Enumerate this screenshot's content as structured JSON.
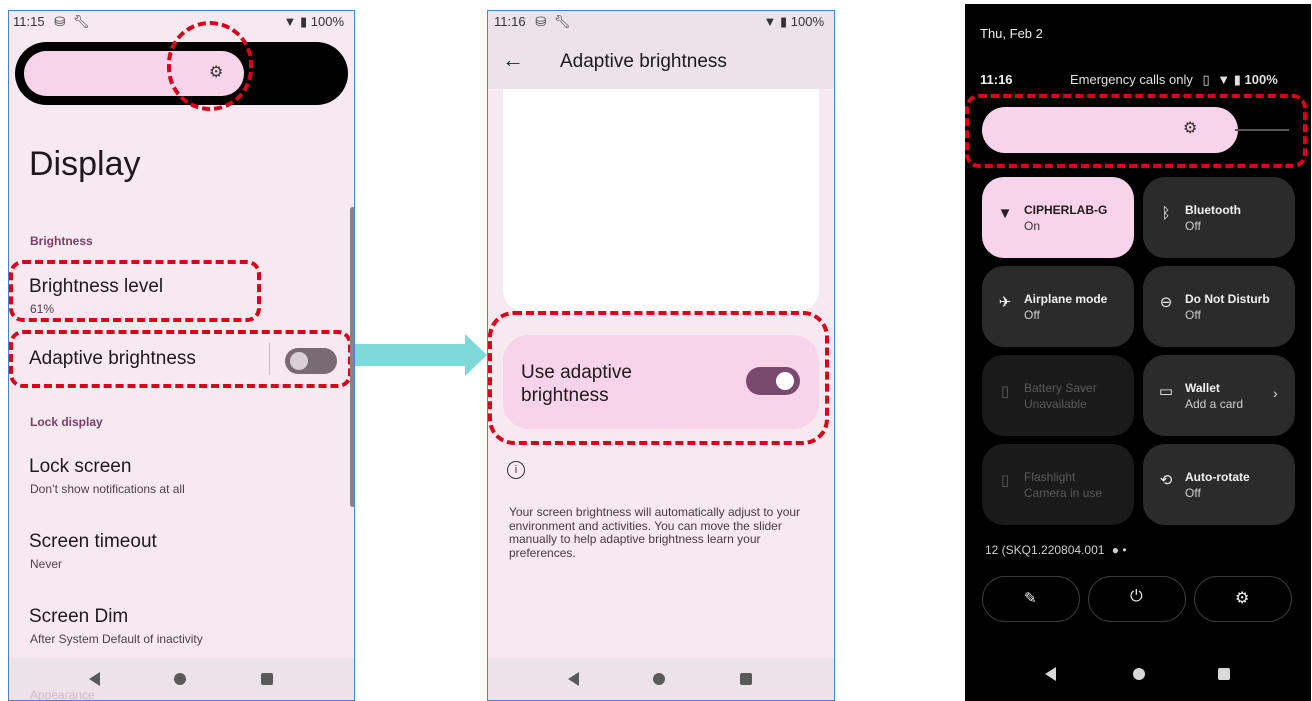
{
  "phone1": {
    "status_time": "11:15",
    "status_battery": "100%",
    "page_title": "Display",
    "section_brightness": "Brightness",
    "brightness_level_title": "Brightness level",
    "brightness_level_value": "61%",
    "adaptive_title": "Adaptive brightness",
    "section_lock": "Lock display",
    "lock_screen_title": "Lock screen",
    "lock_screen_sub": "Don’t show notifications at all",
    "screen_timeout_title": "Screen timeout",
    "screen_timeout_sub": "Never",
    "screen_dim_title": "Screen Dim",
    "screen_dim_sub": "After System Default of inactivity",
    "appearance_partial": "Appearance"
  },
  "phone2": {
    "status_time": "11:16",
    "status_battery": "100%",
    "title": "Adaptive brightness",
    "toggle_label_line1": "Use adaptive",
    "toggle_label_line2": "brightness",
    "info_text": "Your screen brightness will automatically adjust to your environment and activities. You can move the slider manually to help adaptive brightness learn your preferences."
  },
  "phone3": {
    "date": "Thu, Feb 2",
    "time": "11:16",
    "status_text": "Emergency calls only",
    "battery": "100%",
    "tiles": [
      {
        "name": "CIPHERLAB-G",
        "sub": "On"
      },
      {
        "name": "Bluetooth",
        "sub": "Off"
      },
      {
        "name": "Airplane mode",
        "sub": "Off"
      },
      {
        "name": "Do Not Disturb",
        "sub": "Off"
      },
      {
        "name": "Battery Saver",
        "sub": "Unavailable"
      },
      {
        "name": "Wallet",
        "sub": "Add a card"
      },
      {
        "name": "Flashlight",
        "sub": "Camera in use"
      },
      {
        "name": "Auto-rotate",
        "sub": "Off"
      }
    ],
    "build": "12 (SKQ1.220804.001"
  },
  "colors": {
    "highlight_dash": "#d9001b",
    "arrow": "#7fd8d8",
    "accent_purple": "#7a4a6e",
    "tile_on": "#f9d3ea"
  }
}
